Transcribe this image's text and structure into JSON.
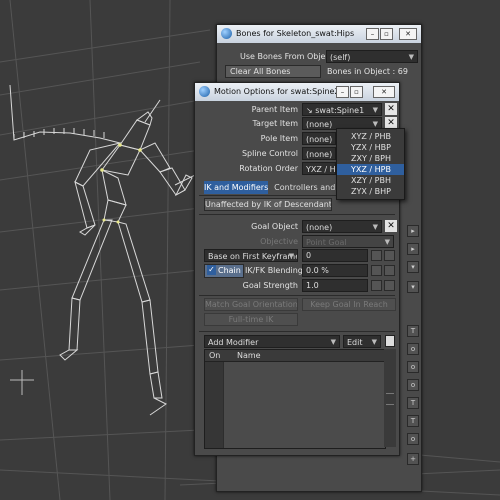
{
  "bones_window": {
    "title": "Bones for Skeleton_swat:Hips",
    "use_bones_label": "Use Bones From Object",
    "use_bones_value": "(self)",
    "clear_all_label": "Clear All Bones",
    "bones_count": "Bones in Object : 69"
  },
  "motion_window": {
    "title": "Motion Options for swat:Spine2",
    "parent_item_label": "Parent Item",
    "parent_item_value": "swat:Spine1",
    "target_item_label": "Target Item",
    "target_item_value": "(none)",
    "pole_item_label": "Pole Item",
    "pole_item_value": "(none)",
    "spline_control_label": "Spline Control",
    "spline_control_value": "(none)",
    "rotation_order_label": "Rotation Order",
    "rotation_order_value": "YXZ / HP",
    "rotation_order_options": [
      "XYZ / PHB",
      "YZX / HBP",
      "ZXY / BPH",
      "YXZ / HPB",
      "XZY / PBH",
      "ZYX / BHP"
    ],
    "rotation_order_current": "YXZ / HPB",
    "tabs": [
      "IK and Modifiers",
      "Controllers and Limits"
    ],
    "unaffected_label": "Unaffected by IK of Descendants",
    "goal_object_label": "Goal Object",
    "goal_object_value": "(none)",
    "objective_label": "Objective",
    "objective_value": "Point Goal",
    "base_on_label": "Base on First Keyframe",
    "base_on_value": "0",
    "chain_label": "Chain",
    "ik_fk_label": "IK/FK Blending",
    "ik_fk_value": "0.0 %",
    "goal_strength_label": "Goal Strength",
    "goal_strength_value": "1.0",
    "match_goal_label": "Match Goal Orientation",
    "keep_goal_label": "Keep Goal In Reach",
    "full_time_ik_label": "Full-time IK",
    "add_modifier_label": "Add Modifier",
    "edit_label": "Edit",
    "col_on": "On",
    "col_name": "Name"
  },
  "colors": {
    "viewport_bg": "#3a3a3a",
    "accent": "#2f5f9e",
    "skeleton": "#d8d8d8",
    "bone_joint": "#e8e88a"
  },
  "icons": {
    "window_icon": "lightwave-icon",
    "close_icon": "x-icon",
    "dropdown": "chevron-down-icon"
  }
}
